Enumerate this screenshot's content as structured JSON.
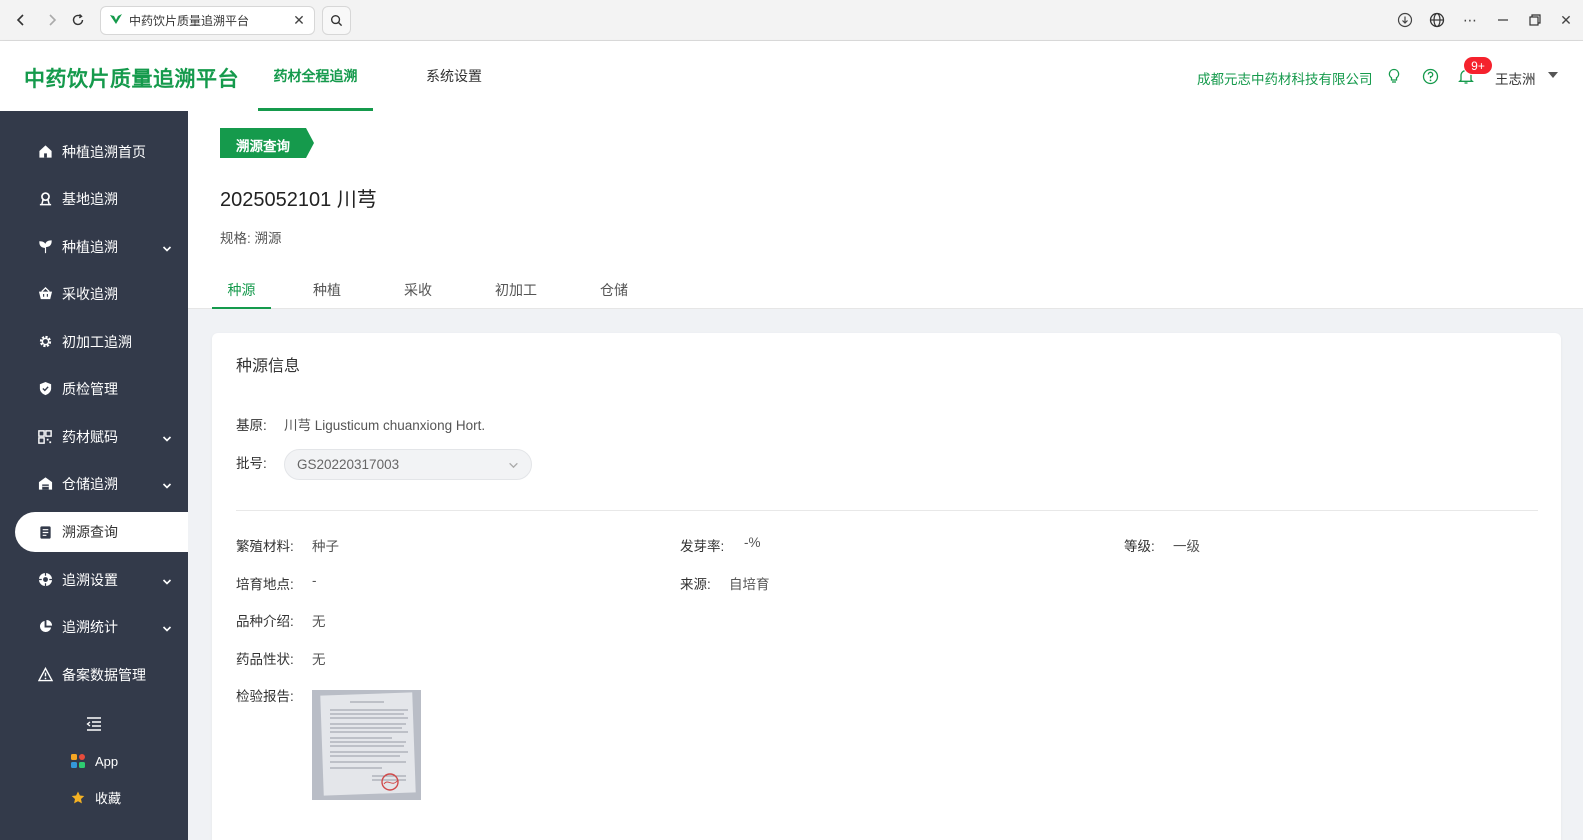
{
  "browser": {
    "tab_title": "中药饮片质量追溯平台"
  },
  "header": {
    "logo": "中药饮片质量追溯平台",
    "nav": [
      {
        "label": "药材全程追溯"
      },
      {
        "label": "系统设置"
      }
    ],
    "company": "成都元志中药材科技有限公司",
    "notification_count": "9+",
    "user": "王志洲"
  },
  "sidebar": {
    "items": [
      {
        "label": "种植追溯首页",
        "icon": "home-icon"
      },
      {
        "label": "基地追溯",
        "icon": "location-icon"
      },
      {
        "label": "种植追溯",
        "icon": "sprout-icon"
      },
      {
        "label": "采收追溯",
        "icon": "basket-icon"
      },
      {
        "label": "初加工追溯",
        "icon": "gear-icon"
      },
      {
        "label": "质检管理",
        "icon": "shield-icon"
      },
      {
        "label": "药材赋码",
        "icon": "qrcode-icon"
      },
      {
        "label": "仓储追溯",
        "icon": "warehouse-icon"
      },
      {
        "label": "溯源查询",
        "icon": "document-icon"
      },
      {
        "label": "追溯设置",
        "icon": "settings-icon"
      },
      {
        "label": "追溯统计",
        "icon": "pie-chart-icon"
      },
      {
        "label": "备案数据管理",
        "icon": "warning-icon"
      }
    ],
    "app_label": "App",
    "favorites_label": "收藏"
  },
  "page": {
    "breadcrumb_tag": "溯源查询",
    "title": "2025052101 川芎",
    "spec_label": "规格:",
    "spec_value": "溯源",
    "tabs": [
      {
        "label": "种源"
      },
      {
        "label": "种植"
      },
      {
        "label": "采收"
      },
      {
        "label": "初加工"
      },
      {
        "label": "仓储"
      }
    ]
  },
  "seed_info": {
    "title": "种源信息",
    "origin_label": "基原:",
    "origin_value": "川芎 Ligusticum chuanxiong Hort.",
    "batch_label": "批号:",
    "batch_value": "GS20220317003",
    "propagation_label": "繁殖材料:",
    "propagation_value": "种子",
    "germination_label": "发芽率:",
    "germination_value": "-%",
    "grade_label": "等级:",
    "grade_value": "一级",
    "cultivation_site_label": "培育地点:",
    "cultivation_site_value": "-",
    "source_label": "来源:",
    "source_value": "自培育",
    "variety_intro_label": "品种介绍:",
    "variety_intro_value": "无",
    "drug_property_label": "药品性状:",
    "drug_property_value": "无",
    "inspection_report_label": "检验报告:"
  },
  "colors": {
    "brand_green": "#159a4c",
    "sidebar_bg": "#333a4a",
    "badge_red": "#f5222d"
  }
}
